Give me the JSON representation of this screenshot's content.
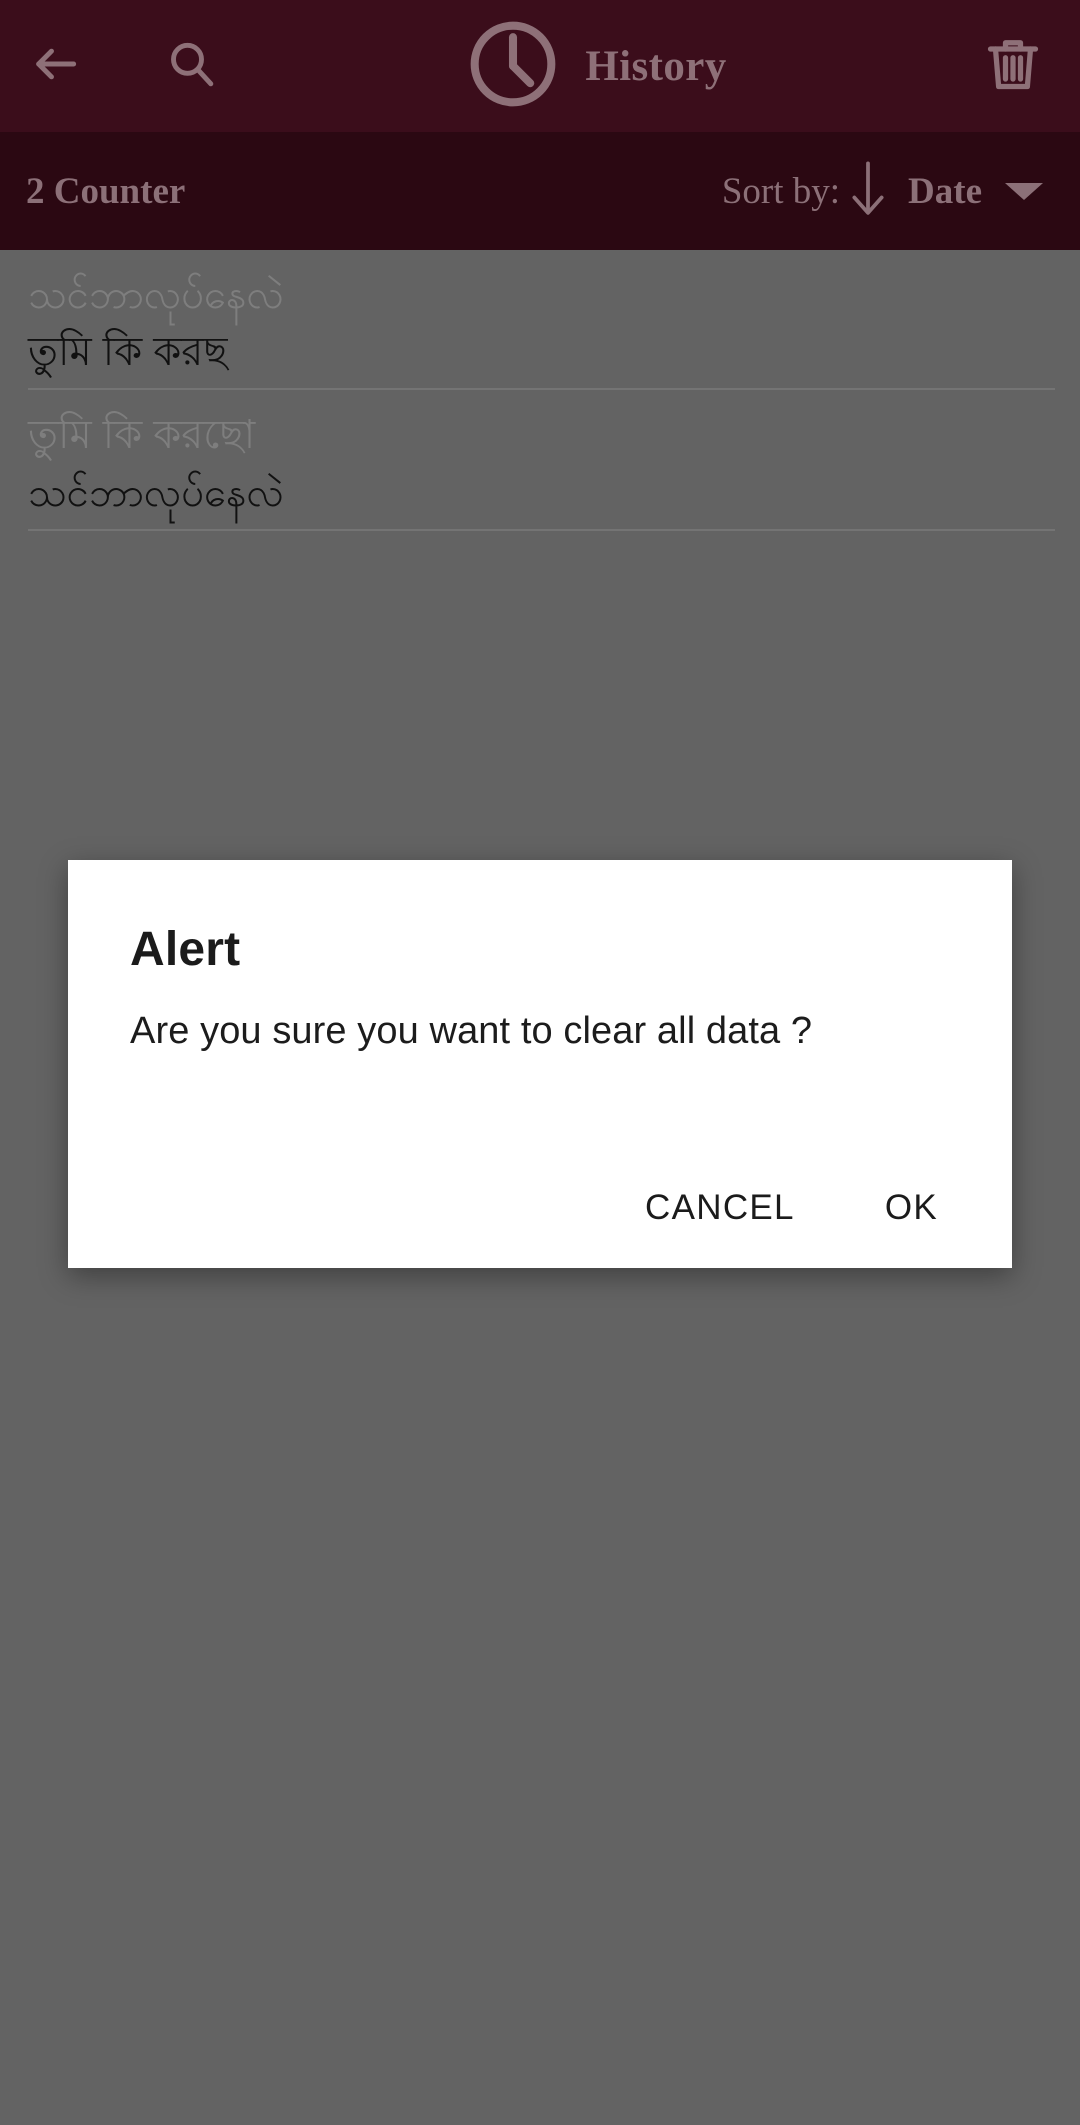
{
  "toolbar": {
    "back_icon": "arrow-left-icon",
    "search_icon": "search-icon",
    "clock_icon": "clock-icon",
    "title": "History",
    "delete_icon": "trash-icon",
    "background_color": "#3B0D1B",
    "foreground_color": "#8E7078"
  },
  "sortbar": {
    "counter_label": "2 Counter",
    "sort_by_label": "Sort by:",
    "sort_direction_icon": "arrow-down-icon",
    "sort_value": "Date",
    "dropdown_icon": "caret-down-icon",
    "background_color": "#2B0812",
    "foreground_color": "#8C7078"
  },
  "list": {
    "background_color": "#636363",
    "items": [
      {
        "secondary_text": "သင်ဘာလုပ်နေလဲ",
        "primary_text": "তুমি কি করছ"
      },
      {
        "secondary_text": "তুমি কি করছো",
        "primary_text": "သင်ဘာလုပ်နေလဲ"
      }
    ]
  },
  "dialog": {
    "title": "Alert",
    "message": "Are you sure you want to clear all data ?",
    "cancel_label": "CANCEL",
    "ok_label": "OK",
    "background_color": "#FFFFFF"
  }
}
